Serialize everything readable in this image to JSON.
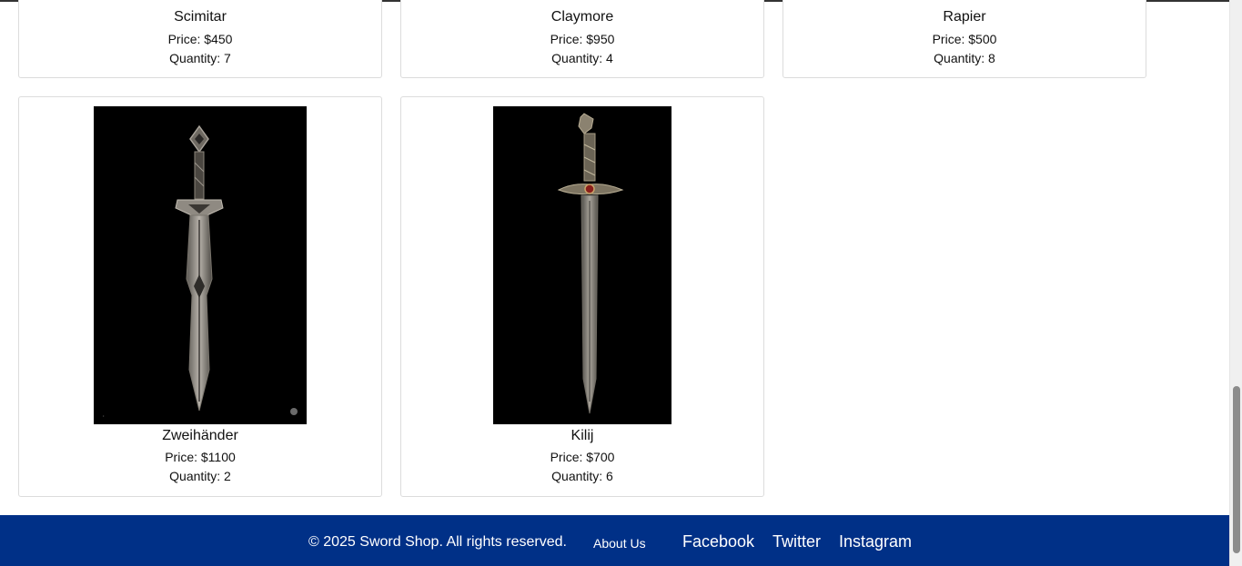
{
  "products_row1": [
    {
      "name": "Scimitar",
      "price": "Price: $450",
      "quantity": "Quantity: 7"
    },
    {
      "name": "Claymore",
      "price": "Price: $950",
      "quantity": "Quantity: 4"
    },
    {
      "name": "Rapier",
      "price": "Price: $500",
      "quantity": "Quantity: 8"
    }
  ],
  "products_row2": [
    {
      "name": "Zweihänder",
      "price": "Price: $1100",
      "quantity": "Quantity: 2"
    },
    {
      "name": "Kilij",
      "price": "Price: $700",
      "quantity": "Quantity: 6"
    }
  ],
  "footer": {
    "copyright": "© 2025 Sword Shop. All rights reserved.",
    "about": "About Us",
    "social": [
      "Facebook",
      "Twitter",
      "Instagram"
    ]
  },
  "colors": {
    "footer_bg": "#003087",
    "image_bg": "#000000"
  }
}
